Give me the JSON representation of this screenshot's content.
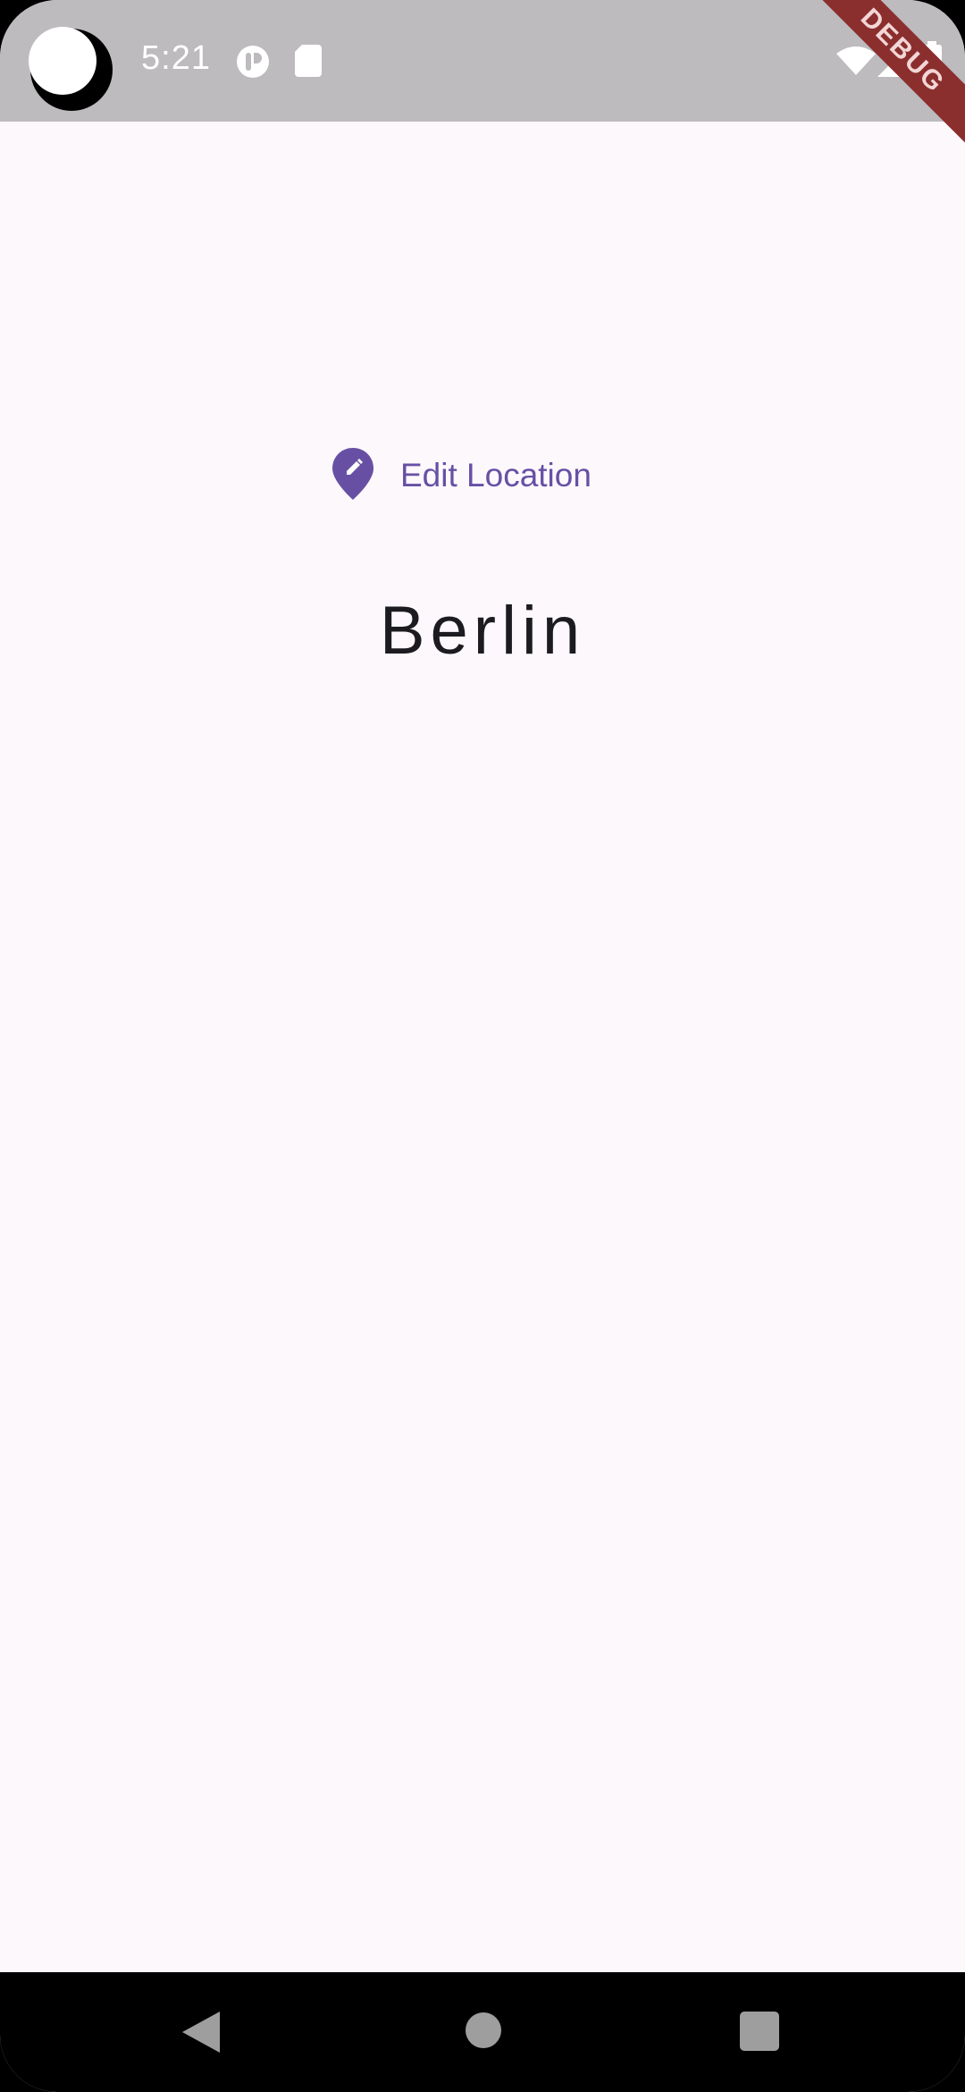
{
  "status_bar": {
    "time": "5:21",
    "debug_banner": "DEBUG",
    "icons": [
      "camera-cutout",
      "notification-app-icon",
      "sd-card-icon",
      "wifi-icon",
      "cell-signal-icon",
      "battery-icon"
    ]
  },
  "main": {
    "edit_location_label": "Edit Location",
    "edit_location_icon": "edit-location-icon",
    "location_name": "Berlin"
  },
  "nav_bar": {
    "icons": [
      "back-icon",
      "home-icon",
      "recents-icon"
    ]
  },
  "colors": {
    "accent": "#6750a4",
    "background": "#fdf8fc",
    "status_bar": "#bdbbbd",
    "debug_ribbon": "#8b2e2e"
  }
}
